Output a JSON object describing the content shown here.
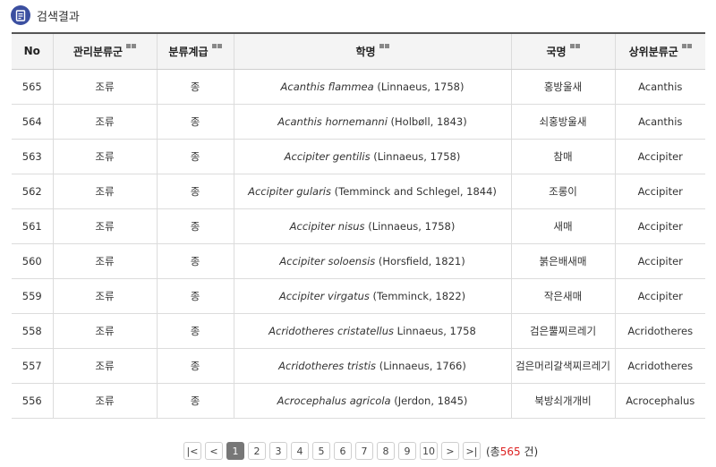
{
  "header": {
    "title": "검색결과"
  },
  "table": {
    "columns": [
      "No",
      "관리분류군",
      "분류계급",
      "학명",
      "국명",
      "상위분류군"
    ],
    "rows": [
      {
        "no": "565",
        "group": "조류",
        "rank": "종",
        "sci_italic": "Acanthis flammea",
        "sci_author": " (Linnaeus, 1758)",
        "kor": "홍방울새",
        "parent": "Acanthis"
      },
      {
        "no": "564",
        "group": "조류",
        "rank": "종",
        "sci_italic": "Acanthis hornemanni",
        "sci_author": " (Holbøll, 1843)",
        "kor": "쇠홍방울새",
        "parent": "Acanthis"
      },
      {
        "no": "563",
        "group": "조류",
        "rank": "종",
        "sci_italic": "Accipiter gentilis",
        "sci_author": " (Linnaeus, 1758)",
        "kor": "참매",
        "parent": "Accipiter"
      },
      {
        "no": "562",
        "group": "조류",
        "rank": "종",
        "sci_italic": "Accipiter gularis",
        "sci_author": " (Temminck and Schlegel, 1844)",
        "kor": "조롱이",
        "parent": "Accipiter"
      },
      {
        "no": "561",
        "group": "조류",
        "rank": "종",
        "sci_italic": "Accipiter nisus",
        "sci_author": " (Linnaeus, 1758)",
        "kor": "새매",
        "parent": "Accipiter"
      },
      {
        "no": "560",
        "group": "조류",
        "rank": "종",
        "sci_italic": "Accipiter soloensis",
        "sci_author": " (Horsfield, 1821)",
        "kor": "붉은배새매",
        "parent": "Accipiter"
      },
      {
        "no": "559",
        "group": "조류",
        "rank": "종",
        "sci_italic": "Accipiter virgatus",
        "sci_author": " (Temminck, 1822)",
        "kor": "작은새매",
        "parent": "Accipiter"
      },
      {
        "no": "558",
        "group": "조류",
        "rank": "종",
        "sci_italic": "Acridotheres cristatellus",
        "sci_author": " Linnaeus, 1758",
        "kor": "검은뿔찌르레기",
        "parent": "Acridotheres"
      },
      {
        "no": "557",
        "group": "조류",
        "rank": "종",
        "sci_italic": "Acridotheres tristis",
        "sci_author": " (Linnaeus, 1766)",
        "kor": "검은머리갈색찌르레기",
        "parent": "Acridotheres"
      },
      {
        "no": "556",
        "group": "조류",
        "rank": "종",
        "sci_italic": "Acrocephalus agricola",
        "sci_author": " (Jerdon, 1845)",
        "kor": "북방쇠개개비",
        "parent": "Acrocephalus"
      }
    ]
  },
  "pagination": {
    "first": "|<",
    "prev": "<",
    "pages": [
      "1",
      "2",
      "3",
      "4",
      "5",
      "6",
      "7",
      "8",
      "9",
      "10"
    ],
    "current": "1",
    "next": ">",
    "last": ">|",
    "total_prefix": "(총",
    "total_count": "565",
    "total_suffix": " 건)"
  }
}
